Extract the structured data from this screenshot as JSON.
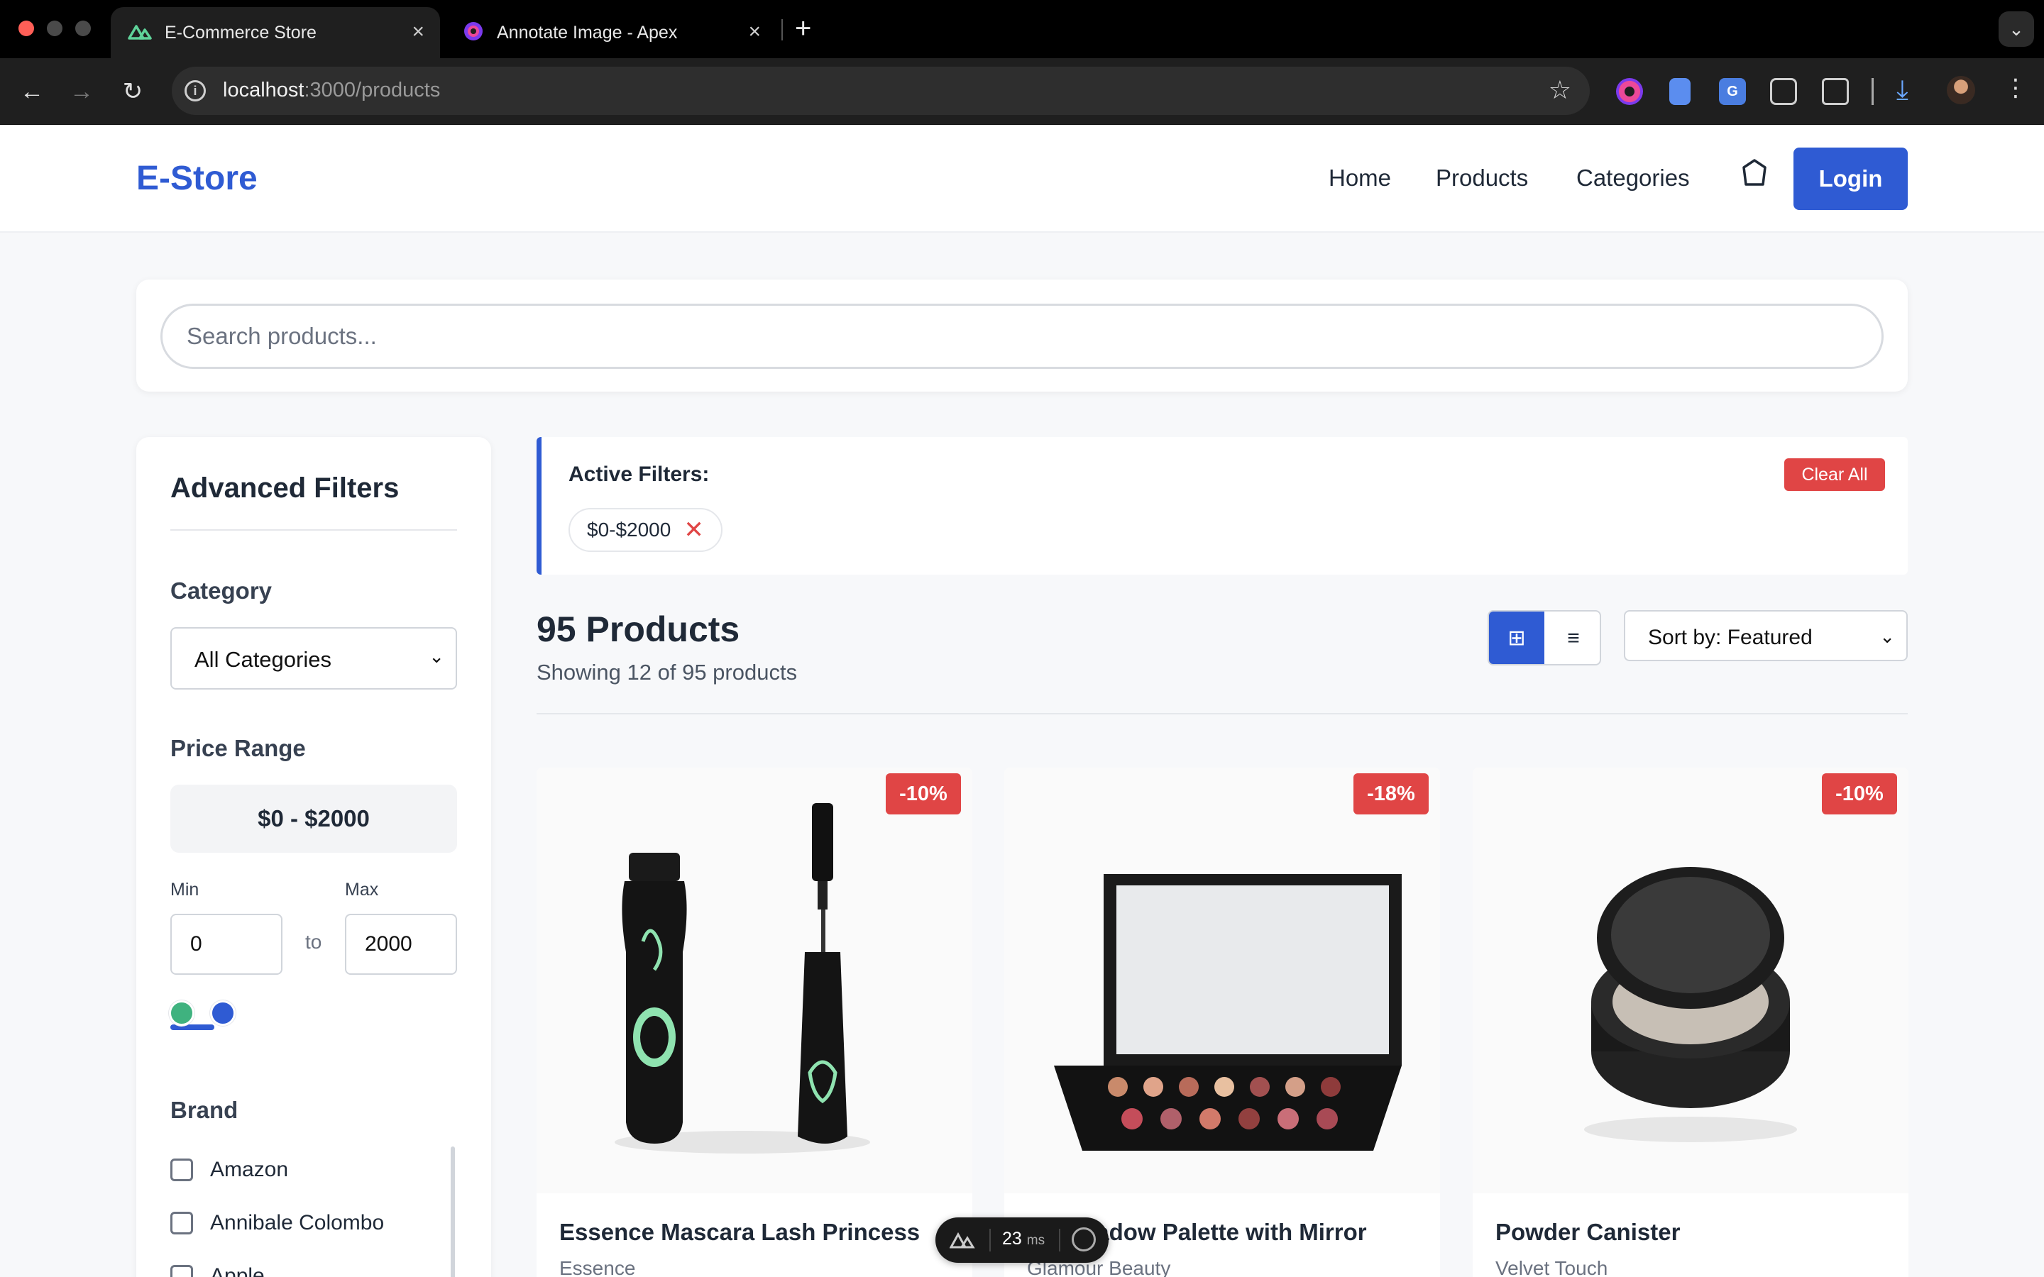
{
  "browser": {
    "tabs": [
      {
        "title": "E-Commerce Store",
        "active": true,
        "icon": "nuxt-icon"
      },
      {
        "title": "Annotate Image - Apex",
        "active": false,
        "icon": "apex-icon"
      }
    ],
    "url_host": "localhost",
    "url_path": ":3000/products",
    "colors": {
      "close": "#ff5f57",
      "minimize": "#febc2e",
      "maximize": "#28c840"
    }
  },
  "site": {
    "logo": "E-Store",
    "nav": {
      "home": "Home",
      "products": "Products",
      "categories": "Categories"
    },
    "login": "Login",
    "accent": "#2f5bd3"
  },
  "search": {
    "placeholder": "Search products..."
  },
  "filters": {
    "title": "Advanced Filters",
    "category_label": "Category",
    "category_value": "All Categories",
    "price_label": "Price Range",
    "price_display": "$0 - $2000",
    "min_label": "Min",
    "max_label": "Max",
    "min_value": "0",
    "max_value": "2000",
    "to_text": "to",
    "brand_label": "Brand",
    "brands": [
      "Amazon",
      "Annibale Colombo",
      "Apple"
    ]
  },
  "active_filters": {
    "title": "Active Filters:",
    "chips": [
      "$0-$2000"
    ],
    "clear_all": "Clear All"
  },
  "results": {
    "count_title": "95 Products",
    "subtitle": "Showing 12 of 95 products",
    "sort_value": "Sort by: Featured"
  },
  "products": [
    {
      "name": "Essence Mascara Lash Princess",
      "brand": "Essence",
      "discount": "-10%",
      "image": "mascara-image"
    },
    {
      "name": "Eyeshadow Palette with Mirror",
      "brand": "Glamour Beauty",
      "discount": "-18%",
      "image": "eyeshadow-palette-image"
    },
    {
      "name": "Powder Canister",
      "brand": "Velvet Touch",
      "discount": "-10%",
      "image": "powder-canister-image"
    }
  ],
  "devtools": {
    "ms_value": "23",
    "ms_unit": "ms"
  }
}
